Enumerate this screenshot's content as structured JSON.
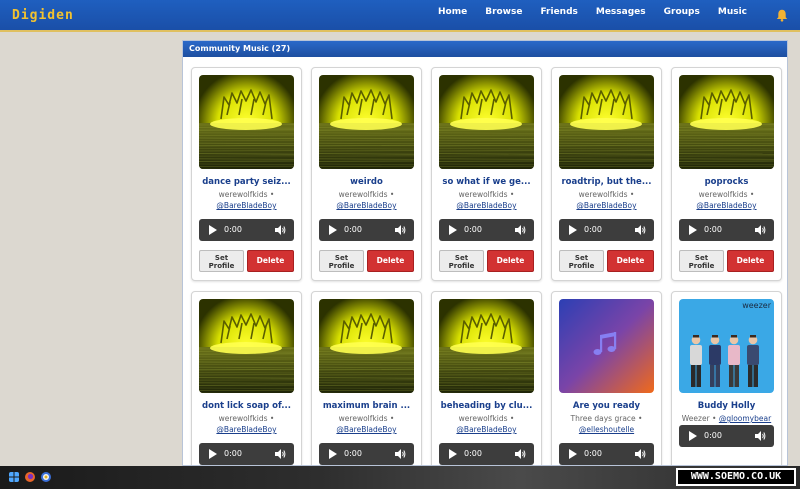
{
  "app": {
    "logo": "Digiden",
    "nav": [
      "Home",
      "Browse",
      "Friends",
      "Messages",
      "Groups",
      "Music"
    ]
  },
  "panel": {
    "title": "Community Music (27)"
  },
  "common": {
    "time": "0:00",
    "set_label": "Set Profile",
    "delete_label": "Delete",
    "sep": "•"
  },
  "tracks": [
    {
      "title": "dance party seiz...",
      "artist": "werewolfkids",
      "uploader": "@BareBladeBoy",
      "cover": "glow"
    },
    {
      "title": "weirdo",
      "artist": "werewolfkids",
      "uploader": "@BareBladeBoy",
      "cover": "glow"
    },
    {
      "title": "so what if we ge...",
      "artist": "werewolfkids",
      "uploader": "@BareBladeBoy",
      "cover": "glow"
    },
    {
      "title": "roadtrip, but the...",
      "artist": "werewolfkids",
      "uploader": "@BareBladeBoy",
      "cover": "glow"
    },
    {
      "title": "poprocks",
      "artist": "werewolfkids",
      "uploader": "@BareBladeBoy",
      "cover": "glow"
    },
    {
      "title": "dont lick soap of...",
      "artist": "werewolfkids",
      "uploader": "@BareBladeBoy",
      "cover": "glow"
    },
    {
      "title": "maximum brain ...",
      "artist": "werewolfkids",
      "uploader": "@BareBladeBoy",
      "cover": "glow"
    },
    {
      "title": "beheading by clu...",
      "artist": "werewolfkids",
      "uploader": "@BareBladeBoy",
      "cover": "glow"
    },
    {
      "title": "Are you ready",
      "artist": "Three days grace",
      "uploader": "@elleshoutelle",
      "cover": "gradient"
    },
    {
      "title": "Buddy Holly",
      "artist": "Weezer",
      "uploader": "@gloomybear",
      "cover": "weezer",
      "cover_text": "weezer"
    }
  ],
  "watermark": "WWW.SOEMO.CO.UK",
  "colors": {
    "header": "#1f5fbf",
    "logo": "#f2c230",
    "title_link": "#1a3f8c",
    "delete": "#d23232"
  }
}
